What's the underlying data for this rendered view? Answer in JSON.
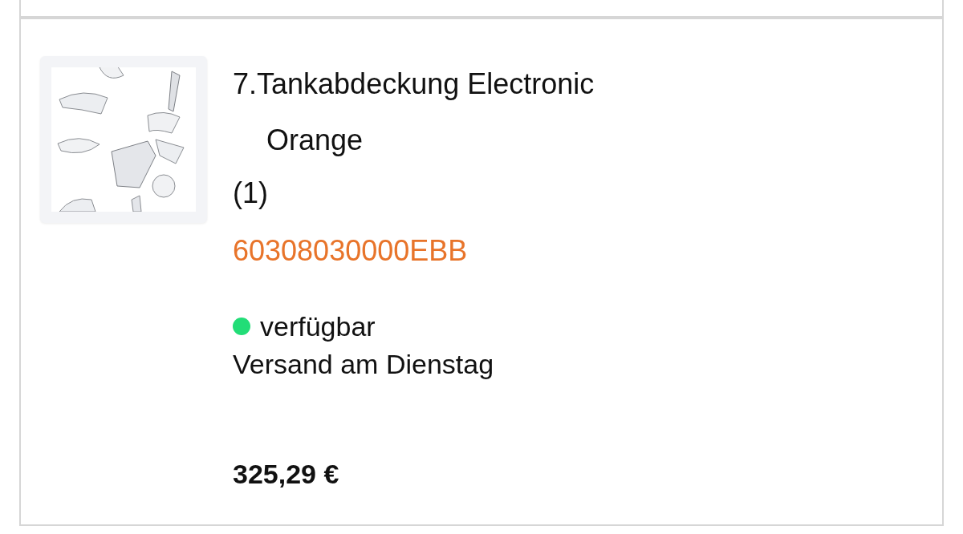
{
  "product": {
    "title": "7.Tankabdeckung Electronic Orange",
    "quantity": "(1)",
    "part_number": "60308030000EBB",
    "availability": {
      "label": "verfügbar",
      "color": "#22dd77"
    },
    "shipping": "Versand am Dienstag",
    "price": "325,29 €"
  }
}
